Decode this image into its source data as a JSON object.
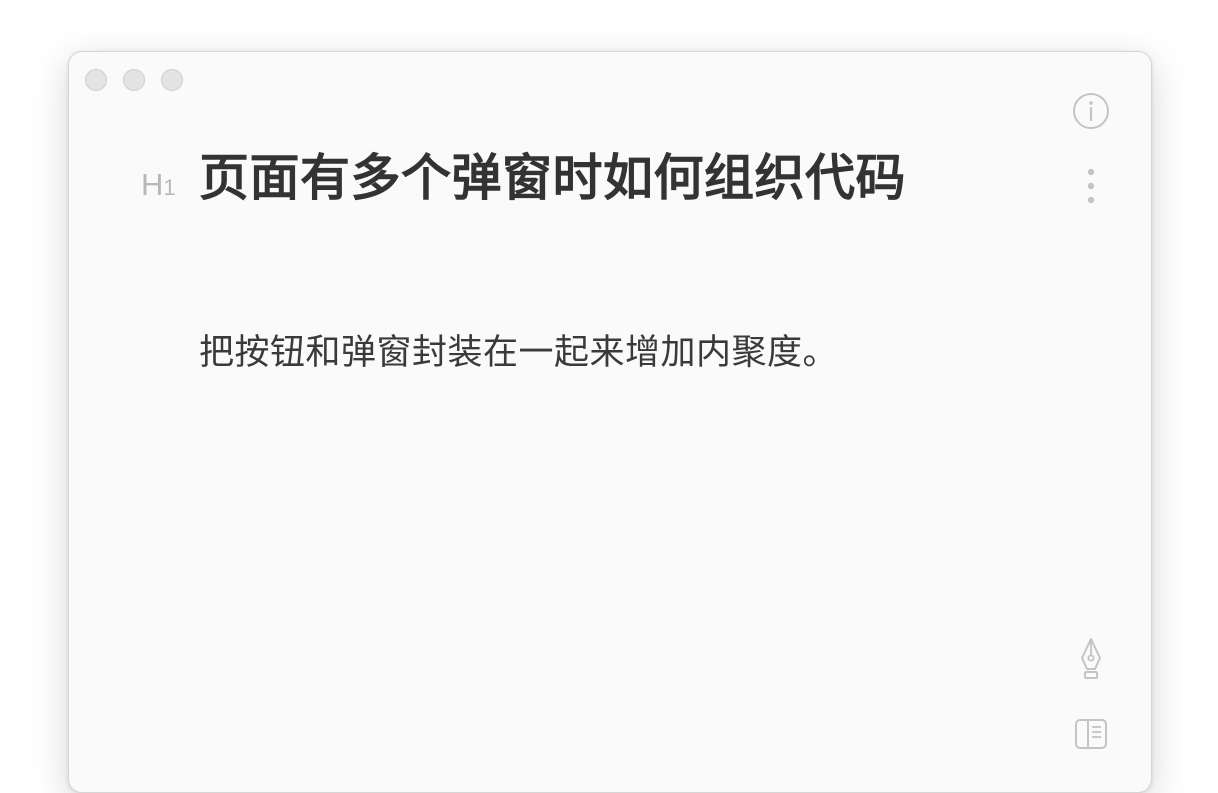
{
  "window": {
    "traffic_lights": [
      "close",
      "minimize",
      "zoom"
    ]
  },
  "document": {
    "heading_marker": "H",
    "heading_level": "1",
    "title": "页面有多个弹窗时如何组织代码",
    "body": "把按钮和弹窗封装在一起来增加内聚度。"
  },
  "toolbar": {
    "icons": [
      "info-icon",
      "more-icon",
      "pen-icon",
      "sidebar-icon"
    ]
  },
  "colors": {
    "window_bg": "#fafafa",
    "title": "#333333",
    "body_text": "#3a3a3a",
    "marker": "#b8b8b8",
    "icon": "#c4c4c4"
  }
}
